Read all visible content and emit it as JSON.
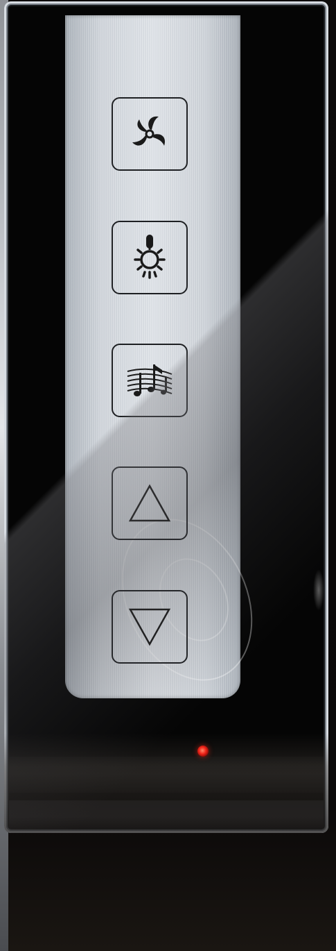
{
  "device": {
    "type": "touch keypad",
    "led_color": "#f2261a",
    "strip_color": "#d5dadf",
    "glass_color": "#050505"
  },
  "keys": [
    {
      "icon": "fan-icon"
    },
    {
      "icon": "light-bulb-icon"
    },
    {
      "icon": "music-icon"
    },
    {
      "icon": "up-arrow-icon"
    },
    {
      "icon": "down-arrow-icon"
    }
  ]
}
